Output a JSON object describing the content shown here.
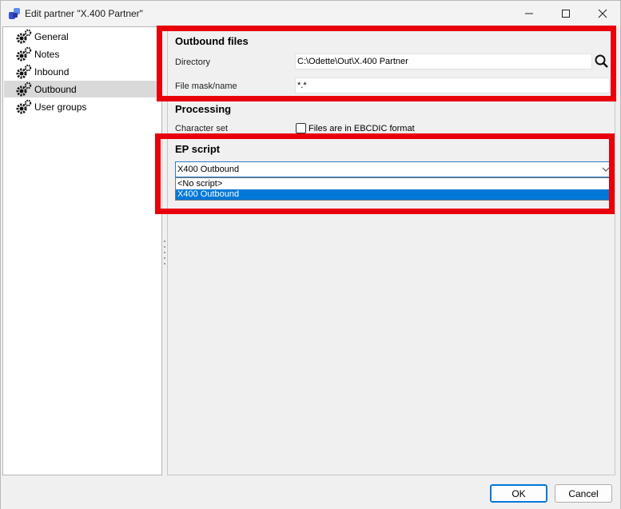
{
  "window": {
    "title": "Edit partner \"X.400 Partner\"",
    "controls": {
      "minimize": "—",
      "maximize": "☐",
      "close": "✕"
    }
  },
  "sidebar": {
    "items": [
      {
        "label": "General",
        "icon": "gear-icon"
      },
      {
        "label": "Notes",
        "icon": "gear-icon"
      },
      {
        "label": "Inbound",
        "icon": "gear-icon"
      },
      {
        "label": "Outbound",
        "icon": "gear-icon",
        "selected": true
      },
      {
        "label": "User groups",
        "icon": "gear-icon"
      }
    ]
  },
  "outbound_files": {
    "title": "Outbound files",
    "directory_label": "Directory",
    "directory_value": "C:\\Odette\\Out\\X.400 Partner",
    "file_mask_label": "File mask/name",
    "file_mask_value": "*.*"
  },
  "processing": {
    "title": "Processing",
    "charset_label": "Character set",
    "ebcdic_label": "Files are in EBCDIC format",
    "ebcdic_checked": false
  },
  "ep_script": {
    "title": "EP script",
    "selected": "X400 Outbound",
    "options": [
      "<No script>",
      "X400 Outbound"
    ]
  },
  "buttons": {
    "ok": "OK",
    "cancel": "Cancel"
  },
  "colors": {
    "highlight_box": "#e8000b",
    "selection": "#0078d7"
  }
}
